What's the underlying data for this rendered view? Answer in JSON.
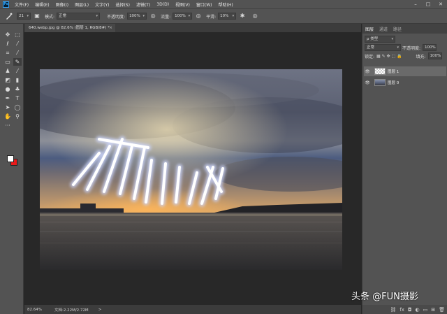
{
  "menubar": {
    "logo": "Ps",
    "items": [
      "文件(F)",
      "编辑(E)",
      "图像(I)",
      "图层(L)",
      "文字(Y)",
      "选择(S)",
      "滤镜(T)",
      "3D(D)",
      "视图(V)",
      "窗口(W)",
      "帮助(H)"
    ]
  },
  "window_controls": {
    "minimize": "–",
    "maximize": "□",
    "close": "✕"
  },
  "options": {
    "brush_size": "21",
    "mode_label": "模式:",
    "mode_value": "正常",
    "opacity_label": "不透明度:",
    "opacity_value": "100%",
    "flow_label": "流量:",
    "flow_value": "100%",
    "smooth_label": "平滑:",
    "smooth_value": "10%"
  },
  "document": {
    "tab_title": "640.webp.jpg @ 82.6% (图层 1, RGB/8#) *",
    "tab_close": "×"
  },
  "status": {
    "zoom": "82.64%",
    "doc_info": "文档:2.22M/2.72M",
    "arrow": ">"
  },
  "panel": {
    "tabs": [
      "图层",
      "通道",
      "路径"
    ],
    "filter_label": "ρ 类型",
    "blend_mode": "正常",
    "opacity_label": "不透明度:",
    "opacity_value": "100%",
    "lock_label": "锁定:",
    "fill_label": "填充:",
    "fill_value": "100%",
    "layers": [
      {
        "name": "图层 1",
        "visible": "👁",
        "selected": true
      },
      {
        "name": "图层 0",
        "visible": "👁",
        "selected": false
      }
    ]
  },
  "tools": [
    "move-icon",
    "marquee-icon",
    "lasso-icon",
    "quick-select-icon",
    "crop-icon",
    "eyedropper-icon",
    "healing-icon",
    "brush-icon",
    "stamp-icon",
    "history-brush-icon",
    "eraser-icon",
    "gradient-icon",
    "blur-icon",
    "dodge-icon",
    "pen-icon",
    "type-icon",
    "path-select-icon",
    "shape-icon",
    "hand-icon",
    "zoom-icon",
    "more-icon"
  ],
  "colors": {
    "foreground": "#ffffff",
    "background": "#e81a1a",
    "accent": "#31a8ff"
  },
  "watermark": "头条 @FUN摄影"
}
